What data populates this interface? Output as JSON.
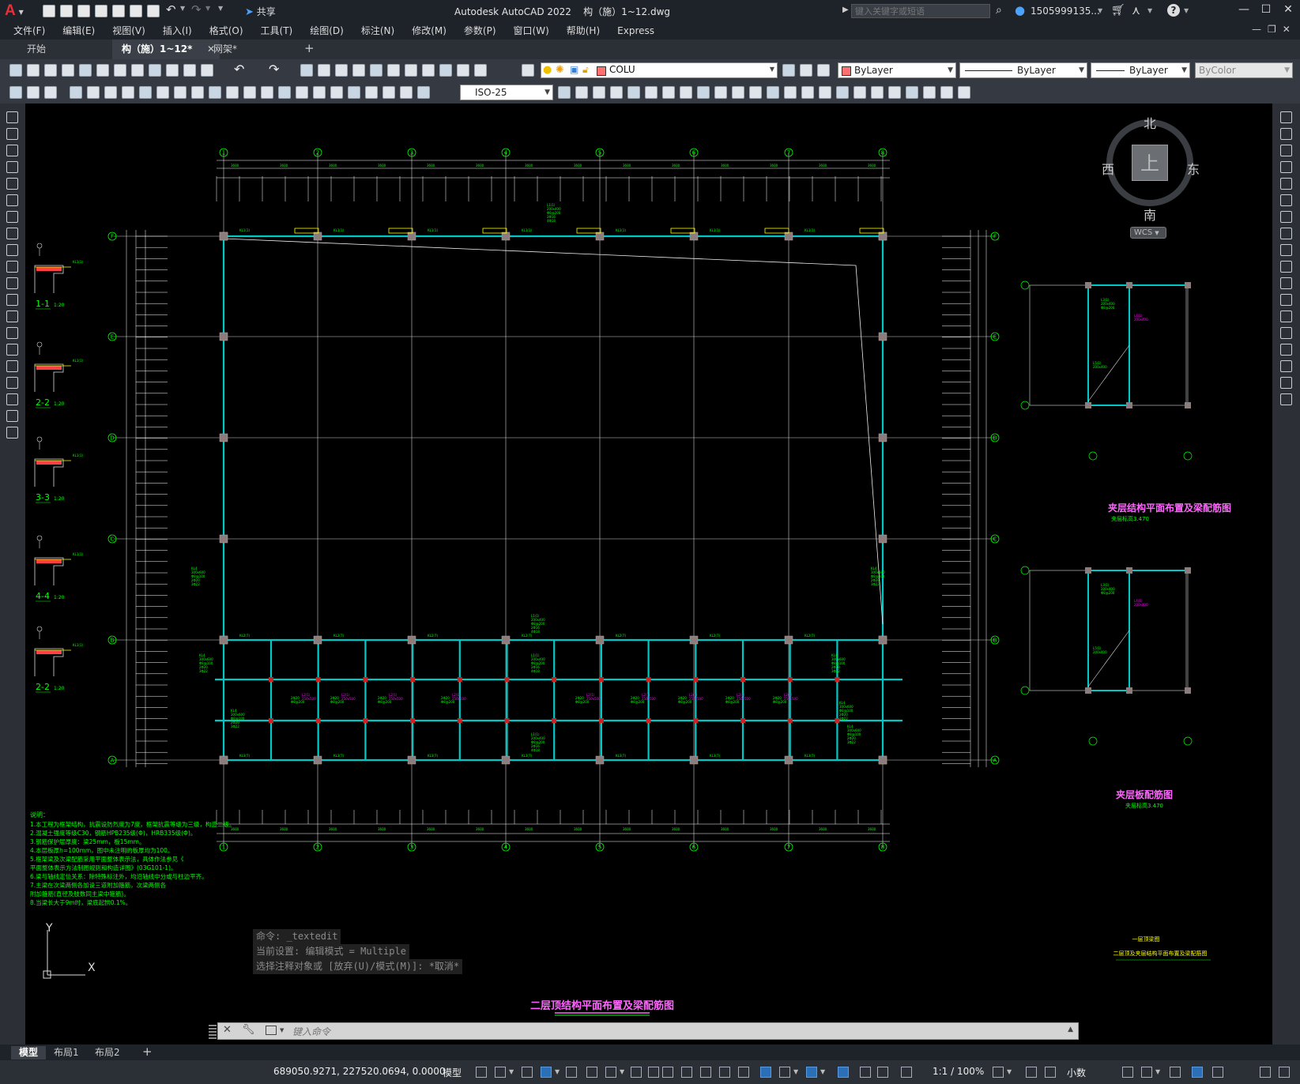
{
  "titlebar": {
    "app_logo": "A",
    "share_label": "共享",
    "title": "Autodesk AutoCAD 2022    构（施）1~12.dwg",
    "search_placeholder": "键入关键字或短语",
    "user": "1505999135...",
    "help_icon": "?"
  },
  "menu": [
    "文件(F)",
    "编辑(E)",
    "视图(V)",
    "插入(I)",
    "格式(O)",
    "工具(T)",
    "绘图(D)",
    "标注(N)",
    "修改(M)",
    "参数(P)",
    "窗口(W)",
    "帮助(H)",
    "Express"
  ],
  "doc_tabs": [
    {
      "label": "开始",
      "active": false
    },
    {
      "label": "构（施）1~12*",
      "active": true
    },
    {
      "label": "网架*",
      "active": false
    }
  ],
  "toolbar": {
    "layer": "COLU",
    "color": "ByLayer",
    "linetype": "ByLayer",
    "lineweight": "ByLayer",
    "plotstyle": "ByColor",
    "dimstyle": "ISO-25"
  },
  "viewcube": {
    "north": "北",
    "south": "南",
    "east": "东",
    "west": "西",
    "top": "上",
    "wcs": "WCS"
  },
  "drawing": {
    "grid_x_labels": [
      "1",
      "2",
      "3",
      "4",
      "5",
      "6",
      "7",
      "8"
    ],
    "grid_y_labels": [
      "F",
      "E",
      "D",
      "C",
      "B",
      "A"
    ],
    "main_title": "二层顶结构平面布置及梁配筋图",
    "side_title_1": "夹层结构平面布置及梁配筋图",
    "side_sub_1": "夹层标高3.470",
    "side_title_2": "夹层板配筋图",
    "side_sub_2": "夹层标高3.470",
    "sections": [
      "1-1",
      "2-2",
      "3-3",
      "4-4",
      "2-2"
    ],
    "section_scale": "1:20",
    "notes_heading": "说明：",
    "notes": [
      "1.本工程为框架结构，抗震设防烈度为7度，框架抗震等级为三级，构造二级。",
      "2.混凝土强度等级C30，钢筋HPB235级(Φ)，HRB335级(Φ)。",
      "3.钢筋保护层厚度：梁25mm，板15mm。",
      "4.本层板厚h=100mm，图中未注明的板厚均为100。",
      "5.框架梁及次梁配筋采用平面整体表示法，具体作法参见《",
      "   平面整体表示方法制图规则和构造详图》(03G101-1)。",
      "6.梁与轴线定位关系：除特殊标注外，均沿轴线中分或与柱边平齐。",
      "7.主梁在次梁两侧各加设三道附加箍筋，次梁两侧各",
      "   附加箍筋(直径及肢数同主梁中箍筋)。",
      "8.当梁长大于9m时，梁底起拱0.1%。"
    ],
    "titleblock_1": "一层顶梁图",
    "titleblock_2": "二层顶及夹层结构平面布置及梁配筋图",
    "ucs_y": "Y",
    "ucs_x": "X"
  },
  "command": {
    "history": [
      "命令: _textedit",
      "当前设置: 编辑模式 = Multiple",
      "选择注释对象或 [放弃(U)/模式(M)]: *取消*"
    ],
    "placeholder": "键入命令"
  },
  "layout_tabs": [
    {
      "label": "模型",
      "active": true
    },
    {
      "label": "布局1",
      "active": false
    },
    {
      "label": "布局2",
      "active": false
    }
  ],
  "status": {
    "coords": "689050.9271, 227520.0694, 0.0000",
    "mode": "模型",
    "scale": "1:1 / 100%",
    "units": "小数"
  },
  "colors": {
    "grid_line": "#d9d9d9",
    "beam": "#00c8c8",
    "text_green": "#00ff00",
    "column": "#9a8a8a",
    "accent_blue": "#2a6fb8"
  }
}
